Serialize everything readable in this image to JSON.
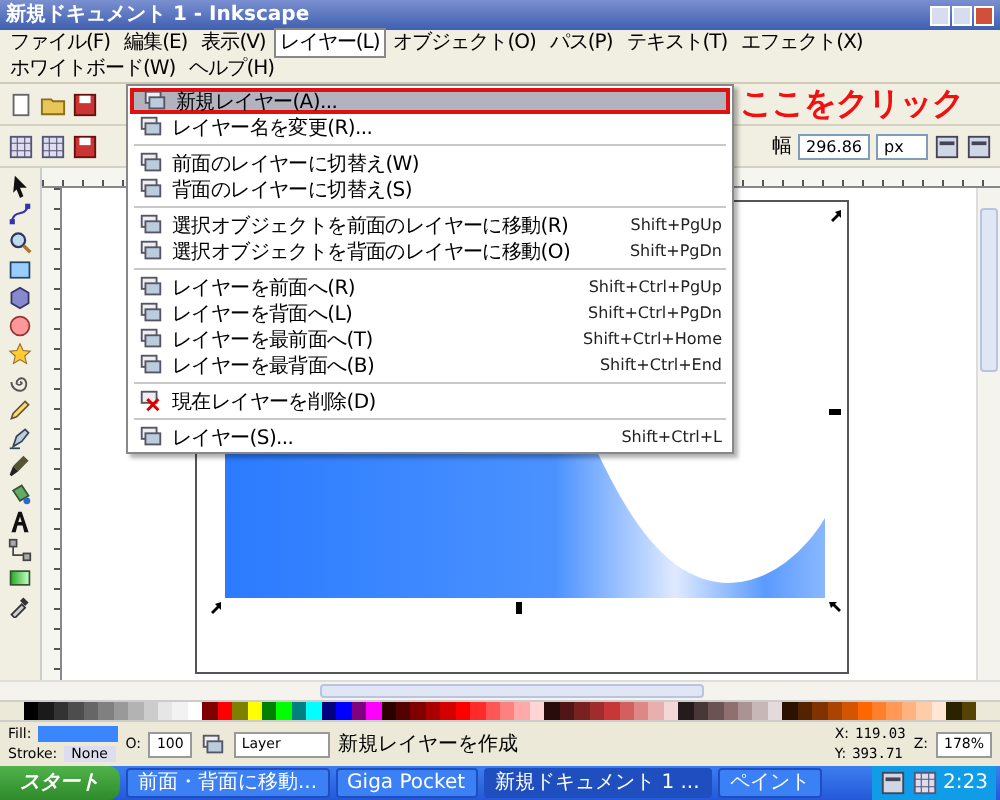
{
  "window": {
    "title": "新規ドキュメント 1 - Inkscape"
  },
  "menubar": [
    {
      "label": "ファイル(F)",
      "selected": false
    },
    {
      "label": "編集(E)",
      "selected": false
    },
    {
      "label": "表示(V)",
      "selected": false
    },
    {
      "label": "レイヤー(L)",
      "selected": true
    },
    {
      "label": "オブジェクト(O)",
      "selected": false
    },
    {
      "label": "パス(P)",
      "selected": false
    },
    {
      "label": "テキスト(T)",
      "selected": false
    },
    {
      "label": "エフェクト(X)",
      "selected": false
    },
    {
      "label": "ホワイトボード(W)",
      "selected": false
    },
    {
      "label": "ヘルプ(H)",
      "selected": false
    }
  ],
  "layer_menu": [
    {
      "kind": "item",
      "label": "新規レイヤー(A)...",
      "selected": true,
      "marked": true
    },
    {
      "kind": "item",
      "label": "レイヤー名を変更(R)...",
      "selected": false,
      "marked": false
    },
    {
      "kind": "separator"
    },
    {
      "kind": "item",
      "label": "前面のレイヤーに切替え(W)",
      "selected": false,
      "marked": false
    },
    {
      "kind": "item",
      "label": "背面のレイヤーに切替え(S)",
      "selected": false,
      "marked": false
    },
    {
      "kind": "separator"
    },
    {
      "kind": "item",
      "label": "選択オブジェクトを前面のレイヤーに移動(R)",
      "shortcut": "Shift+PgUp",
      "selected": false,
      "marked": false
    },
    {
      "kind": "item",
      "label": "選択オブジェクトを背面のレイヤーに移動(O)",
      "shortcut": "Shift+PgDn",
      "selected": false,
      "marked": false
    },
    {
      "kind": "separator"
    },
    {
      "kind": "item",
      "label": "レイヤーを前面へ(R)",
      "shortcut": "Shift+Ctrl+PgUp",
      "selected": false,
      "marked": false
    },
    {
      "kind": "item",
      "label": "レイヤーを背面へ(L)",
      "shortcut": "Shift+Ctrl+PgDn",
      "selected": false,
      "marked": false
    },
    {
      "kind": "item",
      "label": "レイヤーを最前面へ(T)",
      "shortcut": "Shift+Ctrl+Home",
      "selected": false,
      "marked": false
    },
    {
      "kind": "item",
      "label": "レイヤーを最背面へ(B)",
      "shortcut": "Shift+Ctrl+End",
      "selected": false,
      "marked": false
    },
    {
      "kind": "separator"
    },
    {
      "kind": "item",
      "label": "現在レイヤーを削除(D)",
      "selected": false,
      "marked": false
    },
    {
      "kind": "separator"
    },
    {
      "kind": "item",
      "label": "レイヤー(S)...",
      "shortcut": "Shift+Ctrl+L",
      "selected": false,
      "marked": false
    }
  ],
  "callout": {
    "text": "ここをクリック"
  },
  "tool_controls": {
    "label": "幅",
    "value": "296.86",
    "unit": "px"
  },
  "palette": [
    {
      "color": "#000000"
    },
    {
      "color": "#1a1a1a"
    },
    {
      "color": "#333333"
    },
    {
      "color": "#4d4d4d"
    },
    {
      "color": "#666666"
    },
    {
      "color": "#808080"
    },
    {
      "color": "#999999"
    },
    {
      "color": "#b3b3b3"
    },
    {
      "color": "#cccccc"
    },
    {
      "color": "#e6e6e6"
    },
    {
      "color": "#f2f2f2"
    },
    {
      "color": "#ffffff"
    },
    {
      "color": "#800000"
    },
    {
      "color": "#ff0000"
    },
    {
      "color": "#808000"
    },
    {
      "color": "#ffff00"
    },
    {
      "color": "#008000"
    },
    {
      "color": "#00ff00"
    },
    {
      "color": "#008080"
    },
    {
      "color": "#00ffff"
    },
    {
      "color": "#000080"
    },
    {
      "color": "#0000ff"
    },
    {
      "color": "#800080"
    },
    {
      "color": "#ff00ff"
    },
    {
      "color": "#2b0000"
    },
    {
      "color": "#550000"
    },
    {
      "color": "#800000"
    },
    {
      "color": "#aa0000"
    },
    {
      "color": "#d40000"
    },
    {
      "color": "#ff0000"
    },
    {
      "color": "#ff2a2a"
    },
    {
      "color": "#ff5555"
    },
    {
      "color": "#ff8080"
    },
    {
      "color": "#ffaaaa"
    },
    {
      "color": "#ffd5d5"
    },
    {
      "color": "#280b0b"
    },
    {
      "color": "#501616"
    },
    {
      "color": "#782121"
    },
    {
      "color": "#a02c2c"
    },
    {
      "color": "#c83737"
    },
    {
      "color": "#d35f5f"
    },
    {
      "color": "#de8787"
    },
    {
      "color": "#e9afaf"
    },
    {
      "color": "#f4d7d7"
    },
    {
      "color": "#241c1c"
    },
    {
      "color": "#483737"
    },
    {
      "color": "#6c5353"
    },
    {
      "color": "#916f6f"
    },
    {
      "color": "#ac9393"
    },
    {
      "color": "#c8b7b7"
    },
    {
      "color": "#e3dbdb"
    },
    {
      "color": "#2b1100"
    },
    {
      "color": "#552200"
    },
    {
      "color": "#803300"
    },
    {
      "color": "#aa4400"
    },
    {
      "color": "#d45500"
    },
    {
      "color": "#ff6600"
    },
    {
      "color": "#ff7f2a"
    },
    {
      "color": "#ff9955"
    },
    {
      "color": "#ffb380"
    },
    {
      "color": "#ffccaa"
    },
    {
      "color": "#ffe6d5"
    },
    {
      "color": "#2b2200"
    },
    {
      "color": "#554400"
    }
  ],
  "status_bar": {
    "fill_label": "Fill:",
    "stroke_label": "Stroke:",
    "stroke_value": "None",
    "opacity_label": "O:",
    "opacity_value": "100",
    "layer": "Layer",
    "message": "新規レイヤーを作成",
    "x_label": "X:",
    "x_value": "119.03",
    "y_label": "Y:",
    "y_value": "393.71",
    "zoom_label": "Z:",
    "zoom_value": "178%"
  },
  "taskbar": {
    "start": "スタート",
    "tasks": [
      {
        "label": "前面・背面に移動...",
        "selected": false
      },
      {
        "label": "Giga Pocket",
        "selected": false
      },
      {
        "label": "新規ドキュメント 1 ...",
        "selected": true
      },
      {
        "label": "ペイント",
        "selected": false
      }
    ],
    "clock": "2:23"
  }
}
